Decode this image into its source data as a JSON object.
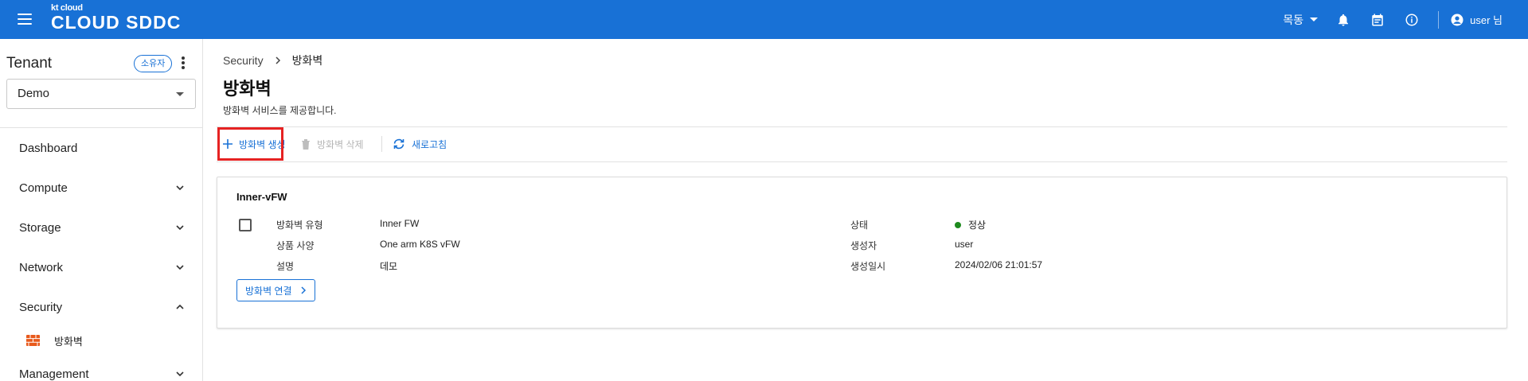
{
  "header": {
    "logo_small": "kt cloud",
    "logo_big": "CLOUD SDDC",
    "region": "목동",
    "user": "user 님"
  },
  "sidebar": {
    "tenant_title": "Tenant",
    "owner_badge": "소유자",
    "tenant_selected": "Demo",
    "items": [
      {
        "label": "Dashboard"
      },
      {
        "label": "Compute"
      },
      {
        "label": "Storage"
      },
      {
        "label": "Network"
      },
      {
        "label": "Security"
      },
      {
        "label": "Management"
      }
    ],
    "security_sub": "방화벽"
  },
  "main": {
    "breadcrumb": [
      "Security",
      "방화벽"
    ],
    "title": "방화벽",
    "description": "방화벽 서비스를 제공합니다.",
    "toolbar": {
      "create_label": "방화벽 생성",
      "delete_label": "방화벽 삭제",
      "refresh_label": "새로고침"
    },
    "card": {
      "title": "Inner-vFW",
      "left": [
        {
          "label": "방화벽 유형",
          "value": "Inner FW"
        },
        {
          "label": "상품 사양",
          "value": "One arm K8S vFW"
        },
        {
          "label": "설명",
          "value": "데모"
        }
      ],
      "right": [
        {
          "label": "상태",
          "value": "정상"
        },
        {
          "label": "생성자",
          "value": "user"
        },
        {
          "label": "생성일시",
          "value": "2024/02/06 21:01:57"
        }
      ],
      "connect_label": "방화벽 연결"
    }
  },
  "colors": {
    "brand": "#1871d6",
    "highlight": "#e62222",
    "status_ok": "#1e8a1e"
  }
}
